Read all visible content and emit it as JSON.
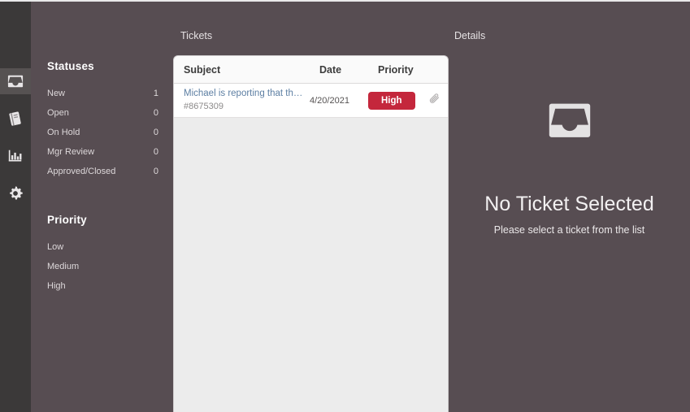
{
  "colors": {
    "app_background": "#574d52",
    "rail_background": "#3b3939",
    "rail_active": "#565252",
    "list_panel_background": "#ececec",
    "row_background": "#ffffff",
    "priority_high_badge": "#c4273c",
    "subject_link": "#5d7fa3"
  },
  "rail": {
    "items": [
      {
        "icon": "inbox-icon",
        "active": true
      },
      {
        "icon": "book-icon",
        "active": false
      },
      {
        "icon": "bar-chart-icon",
        "active": false
      },
      {
        "icon": "gear-icon",
        "active": false
      }
    ]
  },
  "sidebar": {
    "statuses_heading": "Statuses",
    "statuses": [
      {
        "label": "New",
        "count": "1"
      },
      {
        "label": "Open",
        "count": "0"
      },
      {
        "label": "On Hold",
        "count": "0"
      },
      {
        "label": "Mgr Review",
        "count": "0"
      },
      {
        "label": "Approved/Closed",
        "count": "0"
      }
    ],
    "priority_heading": "Priority",
    "priorities": [
      {
        "label": "Low"
      },
      {
        "label": "Medium"
      },
      {
        "label": "High"
      }
    ]
  },
  "captions": {
    "tickets": "Tickets",
    "details": "Details"
  },
  "ticket_list": {
    "columns": {
      "subject": "Subject",
      "date": "Date",
      "priority": "Priority"
    },
    "rows": [
      {
        "subject": "Michael is reporting that th…",
        "number": "#8675309",
        "date": "4/20/2021",
        "priority": "High",
        "attachment_icon": "paperclip-icon"
      }
    ]
  },
  "details": {
    "empty_icon": "inbox-tray-icon",
    "empty_title": "No Ticket Selected",
    "empty_subtitle": "Please select a ticket from the list"
  }
}
